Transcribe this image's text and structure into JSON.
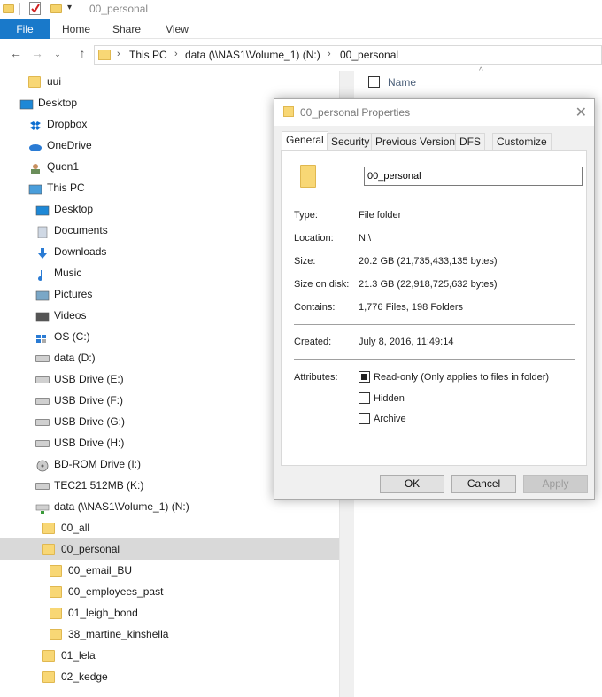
{
  "window": {
    "title": "00_personal",
    "quick_access": [
      "folder-icon",
      "properties-check-icon",
      "folder-icon",
      "customize-dropdown-icon"
    ]
  },
  "ribbon": {
    "tabs": [
      "File",
      "Home",
      "Share",
      "View"
    ]
  },
  "address": {
    "crumbs": [
      "This PC",
      "data (\\\\NAS1\\Volume_1) (N:)",
      "00_personal"
    ]
  },
  "nav": {
    "items": [
      {
        "label": "uui",
        "icon": "folder-icon",
        "indent": 1
      },
      {
        "label": "Desktop",
        "icon": "desktop-icon",
        "indent": 0
      },
      {
        "label": "Dropbox",
        "icon": "dropbox-icon",
        "indent": 1
      },
      {
        "label": "OneDrive",
        "icon": "onedrive-icon",
        "indent": 1
      },
      {
        "label": "Quon1",
        "icon": "user-icon",
        "indent": 1
      },
      {
        "label": "This PC",
        "icon": "computer-icon",
        "indent": 1
      },
      {
        "label": "Desktop",
        "icon": "desktop-icon",
        "indent": 2
      },
      {
        "label": "Documents",
        "icon": "documents-icon",
        "indent": 2
      },
      {
        "label": "Downloads",
        "icon": "downloads-icon",
        "indent": 2
      },
      {
        "label": "Music",
        "icon": "music-icon",
        "indent": 2
      },
      {
        "label": "Pictures",
        "icon": "pictures-icon",
        "indent": 2
      },
      {
        "label": "Videos",
        "icon": "videos-icon",
        "indent": 2
      },
      {
        "label": "OS (C:)",
        "icon": "windows-drive-icon",
        "indent": 2
      },
      {
        "label": "data (D:)",
        "icon": "drive-icon",
        "indent": 2
      },
      {
        "label": "USB Drive (E:)",
        "icon": "drive-icon",
        "indent": 2
      },
      {
        "label": "USB Drive (F:)",
        "icon": "drive-icon",
        "indent": 2
      },
      {
        "label": "USB Drive (G:)",
        "icon": "drive-icon",
        "indent": 2
      },
      {
        "label": "USB Drive (H:)",
        "icon": "drive-icon",
        "indent": 2
      },
      {
        "label": "BD-ROM Drive (I:)",
        "icon": "disc-drive-icon",
        "indent": 2
      },
      {
        "label": "TEC21 512MB (K:)",
        "icon": "usb-stick-icon",
        "indent": 2
      },
      {
        "label": "data (\\\\NAS1\\Volume_1) (N:)",
        "icon": "network-drive-icon",
        "indent": 2
      },
      {
        "label": "00_all",
        "icon": "folder-icon",
        "indent": 3
      },
      {
        "label": "00_personal",
        "icon": "folder-icon",
        "indent": 3,
        "selected": true
      },
      {
        "label": "00_email_BU",
        "icon": "folder-icon",
        "indent": 4
      },
      {
        "label": "00_employees_past",
        "icon": "folder-icon",
        "indent": 4
      },
      {
        "label": "01_leigh_bond",
        "icon": "folder-icon",
        "indent": 4
      },
      {
        "label": "38_martine_kinshella",
        "icon": "folder-icon",
        "indent": 4
      },
      {
        "label": "01_lela",
        "icon": "folder-icon",
        "indent": 3
      },
      {
        "label": "02_kedge",
        "icon": "folder-icon",
        "indent": 3
      }
    ]
  },
  "content": {
    "column_name": "Name"
  },
  "dialog": {
    "title": "00_personal Properties",
    "tabs": [
      "General",
      "Security",
      "Previous Versions",
      "DFS",
      "Customize"
    ],
    "name_value": "00_personal",
    "props": {
      "type_label": "Type:",
      "type_value": "File folder",
      "location_label": "Location:",
      "location_value": "N:\\",
      "size_label": "Size:",
      "size_value": "20.2 GB (21,735,433,135 bytes)",
      "sizeondisk_label": "Size on disk:",
      "sizeondisk_value": "21.3 GB (22,918,725,632 bytes)",
      "contains_label": "Contains:",
      "contains_value": "1,776 Files, 198 Folders",
      "created_label": "Created:",
      "created_value": "July 8, 2016, 11:49:14",
      "attributes_label": "Attributes:"
    },
    "attributes": [
      {
        "label": "Read-only (Only applies to files in folder)",
        "checked": true
      },
      {
        "label": "Hidden",
        "checked": false
      },
      {
        "label": "Archive",
        "checked": false
      }
    ],
    "buttons": {
      "ok": "OK",
      "cancel": "Cancel",
      "apply": "Apply"
    }
  },
  "colors": {
    "accent": "#1979ca",
    "selection": "#d9d9d9",
    "folder": "#f8d775"
  }
}
